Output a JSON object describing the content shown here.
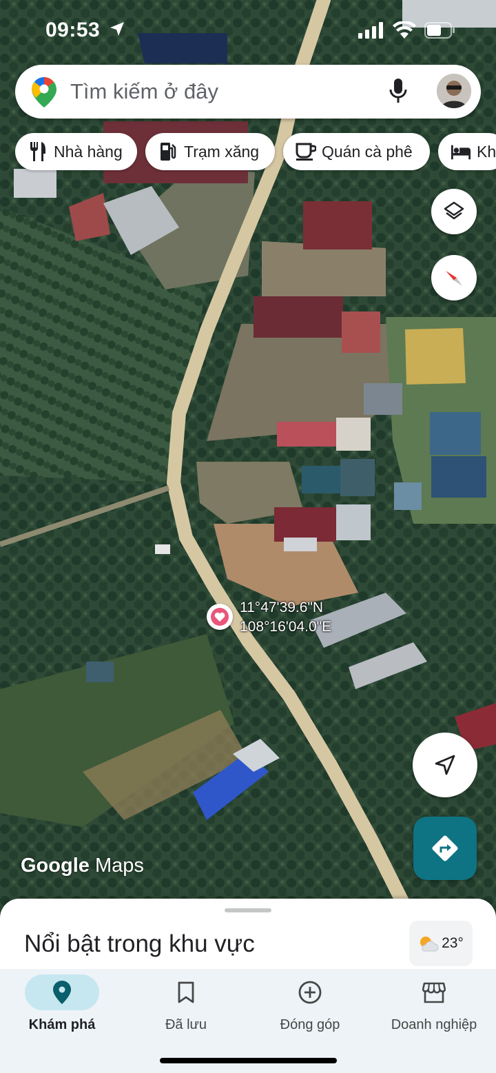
{
  "status_bar": {
    "time": "09:53"
  },
  "search": {
    "placeholder": "Tìm kiếm ở đây"
  },
  "chips": [
    {
      "label": "Nhà hàng",
      "icon": "restaurant-icon"
    },
    {
      "label": "Trạm xăng",
      "icon": "gas-station-icon"
    },
    {
      "label": "Quán cà phê",
      "icon": "coffee-icon"
    },
    {
      "label": "Kh",
      "icon": "hotel-icon"
    }
  ],
  "map": {
    "coordinates": {
      "lat": "11°47'39.6\"N",
      "lng": "108°16'04.0\"E"
    },
    "watermark_google": "Google",
    "watermark_maps": "Maps"
  },
  "sheet": {
    "title": "Nổi bật trong khu vực",
    "temperature": "23°"
  },
  "nav": [
    {
      "label": "Khám phá",
      "icon": "explore-pin-icon",
      "active": true
    },
    {
      "label": "Đã lưu",
      "icon": "bookmark-icon",
      "active": false
    },
    {
      "label": "Đóng góp",
      "icon": "add-circle-icon",
      "active": false
    },
    {
      "label": "Doanh nghiệp",
      "icon": "storefront-icon",
      "active": false
    }
  ],
  "colors": {
    "accent": "#0e7383",
    "nav_bg": "#eef3f7",
    "nav_active_pill": "#c6e7f0",
    "pin": "#e8577a"
  }
}
